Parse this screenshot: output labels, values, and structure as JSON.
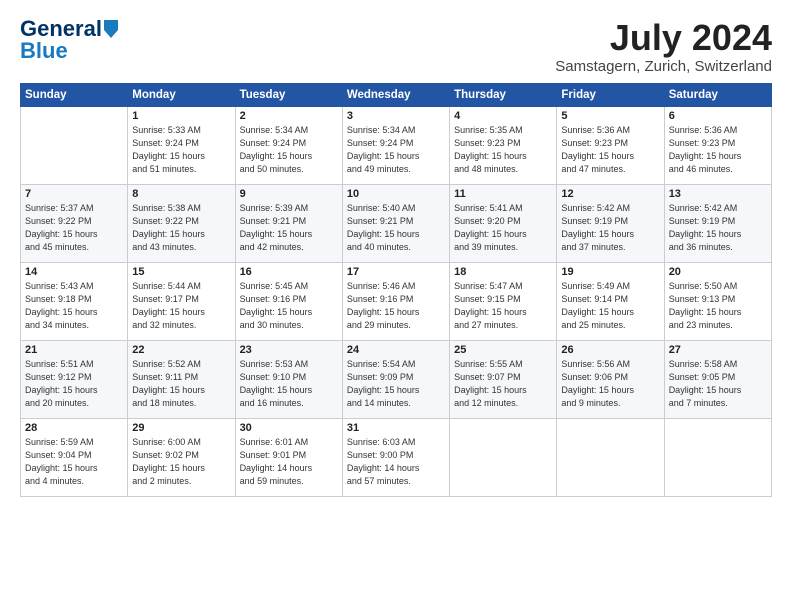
{
  "header": {
    "logo_general": "General",
    "logo_blue": "Blue",
    "month_title": "July 2024",
    "subtitle": "Samstagern, Zurich, Switzerland"
  },
  "weekdays": [
    "Sunday",
    "Monday",
    "Tuesday",
    "Wednesday",
    "Thursday",
    "Friday",
    "Saturday"
  ],
  "weeks": [
    [
      {
        "day": "",
        "text": ""
      },
      {
        "day": "1",
        "text": "Sunrise: 5:33 AM\nSunset: 9:24 PM\nDaylight: 15 hours\nand 51 minutes."
      },
      {
        "day": "2",
        "text": "Sunrise: 5:34 AM\nSunset: 9:24 PM\nDaylight: 15 hours\nand 50 minutes."
      },
      {
        "day": "3",
        "text": "Sunrise: 5:34 AM\nSunset: 9:24 PM\nDaylight: 15 hours\nand 49 minutes."
      },
      {
        "day": "4",
        "text": "Sunrise: 5:35 AM\nSunset: 9:23 PM\nDaylight: 15 hours\nand 48 minutes."
      },
      {
        "day": "5",
        "text": "Sunrise: 5:36 AM\nSunset: 9:23 PM\nDaylight: 15 hours\nand 47 minutes."
      },
      {
        "day": "6",
        "text": "Sunrise: 5:36 AM\nSunset: 9:23 PM\nDaylight: 15 hours\nand 46 minutes."
      }
    ],
    [
      {
        "day": "7",
        "text": "Sunrise: 5:37 AM\nSunset: 9:22 PM\nDaylight: 15 hours\nand 45 minutes."
      },
      {
        "day": "8",
        "text": "Sunrise: 5:38 AM\nSunset: 9:22 PM\nDaylight: 15 hours\nand 43 minutes."
      },
      {
        "day": "9",
        "text": "Sunrise: 5:39 AM\nSunset: 9:21 PM\nDaylight: 15 hours\nand 42 minutes."
      },
      {
        "day": "10",
        "text": "Sunrise: 5:40 AM\nSunset: 9:21 PM\nDaylight: 15 hours\nand 40 minutes."
      },
      {
        "day": "11",
        "text": "Sunrise: 5:41 AM\nSunset: 9:20 PM\nDaylight: 15 hours\nand 39 minutes."
      },
      {
        "day": "12",
        "text": "Sunrise: 5:42 AM\nSunset: 9:19 PM\nDaylight: 15 hours\nand 37 minutes."
      },
      {
        "day": "13",
        "text": "Sunrise: 5:42 AM\nSunset: 9:19 PM\nDaylight: 15 hours\nand 36 minutes."
      }
    ],
    [
      {
        "day": "14",
        "text": "Sunrise: 5:43 AM\nSunset: 9:18 PM\nDaylight: 15 hours\nand 34 minutes."
      },
      {
        "day": "15",
        "text": "Sunrise: 5:44 AM\nSunset: 9:17 PM\nDaylight: 15 hours\nand 32 minutes."
      },
      {
        "day": "16",
        "text": "Sunrise: 5:45 AM\nSunset: 9:16 PM\nDaylight: 15 hours\nand 30 minutes."
      },
      {
        "day": "17",
        "text": "Sunrise: 5:46 AM\nSunset: 9:16 PM\nDaylight: 15 hours\nand 29 minutes."
      },
      {
        "day": "18",
        "text": "Sunrise: 5:47 AM\nSunset: 9:15 PM\nDaylight: 15 hours\nand 27 minutes."
      },
      {
        "day": "19",
        "text": "Sunrise: 5:49 AM\nSunset: 9:14 PM\nDaylight: 15 hours\nand 25 minutes."
      },
      {
        "day": "20",
        "text": "Sunrise: 5:50 AM\nSunset: 9:13 PM\nDaylight: 15 hours\nand 23 minutes."
      }
    ],
    [
      {
        "day": "21",
        "text": "Sunrise: 5:51 AM\nSunset: 9:12 PM\nDaylight: 15 hours\nand 20 minutes."
      },
      {
        "day": "22",
        "text": "Sunrise: 5:52 AM\nSunset: 9:11 PM\nDaylight: 15 hours\nand 18 minutes."
      },
      {
        "day": "23",
        "text": "Sunrise: 5:53 AM\nSunset: 9:10 PM\nDaylight: 15 hours\nand 16 minutes."
      },
      {
        "day": "24",
        "text": "Sunrise: 5:54 AM\nSunset: 9:09 PM\nDaylight: 15 hours\nand 14 minutes."
      },
      {
        "day": "25",
        "text": "Sunrise: 5:55 AM\nSunset: 9:07 PM\nDaylight: 15 hours\nand 12 minutes."
      },
      {
        "day": "26",
        "text": "Sunrise: 5:56 AM\nSunset: 9:06 PM\nDaylight: 15 hours\nand 9 minutes."
      },
      {
        "day": "27",
        "text": "Sunrise: 5:58 AM\nSunset: 9:05 PM\nDaylight: 15 hours\nand 7 minutes."
      }
    ],
    [
      {
        "day": "28",
        "text": "Sunrise: 5:59 AM\nSunset: 9:04 PM\nDaylight: 15 hours\nand 4 minutes."
      },
      {
        "day": "29",
        "text": "Sunrise: 6:00 AM\nSunset: 9:02 PM\nDaylight: 15 hours\nand 2 minutes."
      },
      {
        "day": "30",
        "text": "Sunrise: 6:01 AM\nSunset: 9:01 PM\nDaylight: 14 hours\nand 59 minutes."
      },
      {
        "day": "31",
        "text": "Sunrise: 6:03 AM\nSunset: 9:00 PM\nDaylight: 14 hours\nand 57 minutes."
      },
      {
        "day": "",
        "text": ""
      },
      {
        "day": "",
        "text": ""
      },
      {
        "day": "",
        "text": ""
      }
    ]
  ]
}
